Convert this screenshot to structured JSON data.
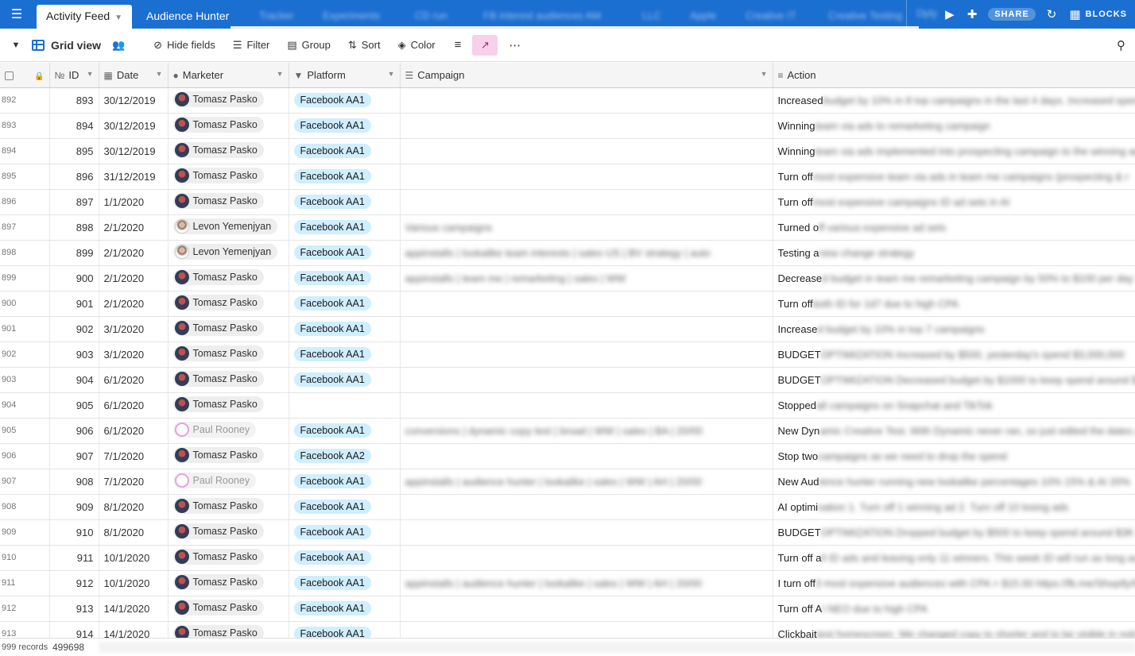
{
  "topbar": {
    "tabs": [
      {
        "label": "Activity Feed",
        "active": true
      },
      {
        "label": "Audience Hunter",
        "active": false
      }
    ],
    "blurred_tabs": [
      "Tracker",
      "Experiments",
      "CD run",
      "FB interest audiences AM",
      "LLC",
      "Apple",
      "Creative IT",
      "Creative Testing"
    ],
    "dply_label": "Dply",
    "share_label": "SHARE",
    "blocks_label": "BLOCKS",
    "accent": "#1b6fd1"
  },
  "toolbar": {
    "view_name": "Grid view",
    "hide_fields": "Hide fields",
    "filter": "Filter",
    "group": "Group",
    "sort": "Sort",
    "color": "Color"
  },
  "columns": {
    "id": "ID",
    "date": "Date",
    "marketer": "Marketer",
    "platform": "Platform",
    "campaign": "Campaign",
    "action": "Action"
  },
  "rows": [
    {
      "n": "892",
      "id": "893",
      "date": "30/12/2019",
      "marketer": "Tomasz Pasko",
      "av": "tomasz",
      "platform": "Facebook AA1",
      "campaign": "",
      "action": "Increased",
      "action_rest": "budget by 10% in 8 top campaigns in the last 4 days. Increased spend"
    },
    {
      "n": "893",
      "id": "894",
      "date": "30/12/2019",
      "marketer": "Tomasz Pasko",
      "av": "tomasz",
      "platform": "Facebook AA1",
      "campaign": "",
      "action": "Winning",
      "action_rest": "team via ads to remarketing campaign"
    },
    {
      "n": "894",
      "id": "895",
      "date": "30/12/2019",
      "marketer": "Tomasz Pasko",
      "av": "tomasz",
      "platform": "Facebook AA1",
      "campaign": "",
      "action": "Winning",
      "action_rest": "team via ads implemented into prospecting campaign to the winning ad"
    },
    {
      "n": "895",
      "id": "896",
      "date": "31/12/2019",
      "marketer": "Tomasz Pasko",
      "av": "tomasz",
      "platform": "Facebook AA1",
      "campaign": "",
      "action": "Turn off",
      "action_rest": "most expensive team via ads in team me campaigns (prospecting & r"
    },
    {
      "n": "896",
      "id": "897",
      "date": "1/1/2020",
      "marketer": "Tomasz Pasko",
      "av": "tomasz",
      "platform": "Facebook AA1",
      "campaign": "",
      "action": "Turn off",
      "action_rest": "most expensive campaigns ID ad sets in AI"
    },
    {
      "n": "897",
      "id": "898",
      "date": "2/1/2020",
      "marketer": "Levon Yemenjyan",
      "av": "levon",
      "platform": "Facebook AA1",
      "campaign": "Various campaigns",
      "action": "Turned o",
      "action_rest": "ff various expensive ad sets"
    },
    {
      "n": "898",
      "id": "899",
      "date": "2/1/2020",
      "marketer": "Levon Yemenjyan",
      "av": "levon",
      "platform": "Facebook AA1",
      "campaign": "appinstalls | lookalike team interests | sales US | BV strategy | auto",
      "action": "Testing a",
      "action_rest": "new change strategy"
    },
    {
      "n": "899",
      "id": "900",
      "date": "2/1/2020",
      "marketer": "Tomasz Pasko",
      "av": "tomasz",
      "platform": "Facebook AA1",
      "campaign": "appinstalls | team me | remarketing | sales | WW",
      "action": "Decrease",
      "action_rest": "d budget in team me remarketing campaign by 50% to $100 per day"
    },
    {
      "n": "900",
      "id": "901",
      "date": "2/1/2020",
      "marketer": "Tomasz Pasko",
      "av": "tomasz",
      "platform": "Facebook AA1",
      "campaign": "",
      "action": "Turn off",
      "action_rest": "both ID for 1d7 due to high CPA"
    },
    {
      "n": "901",
      "id": "902",
      "date": "3/1/2020",
      "marketer": "Tomasz Pasko",
      "av": "tomasz",
      "platform": "Facebook AA1",
      "campaign": "",
      "action": "Increase",
      "action_rest": "d budget by 10% in top 7 campaigns"
    },
    {
      "n": "902",
      "id": "903",
      "date": "3/1/2020",
      "marketer": "Tomasz Pasko",
      "av": "tomasz",
      "platform": "Facebook AA1",
      "campaign": "",
      "action": "BUDGET",
      "action_rest": "OPTIMIZATION Increased by $500, yesterday's spend $3,000,000"
    },
    {
      "n": "903",
      "id": "904",
      "date": "6/1/2020",
      "marketer": "Tomasz Pasko",
      "av": "tomasz",
      "platform": "Facebook AA1",
      "campaign": "",
      "action": "BUDGET",
      "action_rest": "OPTIMIZATION Decreased budget by $1000 to keep spend around $"
    },
    {
      "n": "904",
      "id": "905",
      "date": "6/1/2020",
      "marketer": "Tomasz Pasko",
      "av": "tomasz",
      "platform": "",
      "campaign": "",
      "action": "Stopped",
      "action_rest": "all campaigns on Snapchat and TikTok"
    },
    {
      "n": "905",
      "id": "906",
      "date": "6/1/2020",
      "marketer": "Paul Rooney",
      "av": "paul",
      "platform": "Facebook AA1",
      "campaign": "conversions | dynamic copy test | broad | WW | sales | BA | 20/00",
      "action": "New Dyn",
      "action_rest": "amic Creative Test. With Dynamic never ran, so just edited the dates a"
    },
    {
      "n": "906",
      "id": "907",
      "date": "7/1/2020",
      "marketer": "Tomasz Pasko",
      "av": "tomasz",
      "platform": "Facebook AA2",
      "campaign": "",
      "action": "Stop two",
      "action_rest": "campaigns as we need to drop the spend"
    },
    {
      "n": "907",
      "id": "908",
      "date": "7/1/2020",
      "marketer": "Paul Rooney",
      "av": "paul",
      "platform": "Facebook AA1",
      "campaign": "appinstalls | audience hunter | lookalike | sales | WW | AH | 20/00",
      "action": "New Aud",
      "action_rest": "ience hunter running new lookalike percentages 10% 15% & AI 20%"
    },
    {
      "n": "908",
      "id": "909",
      "date": "8/1/2020",
      "marketer": "Tomasz Pasko",
      "av": "tomasz",
      "platform": "Facebook AA1",
      "campaign": "",
      "action": "AI optimi",
      "action_rest": "sation 1. Turn off 1 winning ad 2. Turn off 10 losing ads"
    },
    {
      "n": "909",
      "id": "910",
      "date": "8/1/2020",
      "marketer": "Tomasz Pasko",
      "av": "tomasz",
      "platform": "Facebook AA1",
      "campaign": "",
      "action": "BUDGET",
      "action_rest": "OPTIMIZATION Dropped budget by $500 to keep spend around $3K"
    },
    {
      "n": "910",
      "id": "911",
      "date": "10/1/2020",
      "marketer": "Tomasz Pasko",
      "av": "tomasz",
      "platform": "Facebook AA1",
      "campaign": "",
      "action": "Turn off a",
      "action_rest": "ll ID ads and leaving only 11 winners. This week ID will run as long as A"
    },
    {
      "n": "911",
      "id": "912",
      "date": "10/1/2020",
      "marketer": "Tomasz Pasko",
      "av": "tomasz",
      "platform": "Facebook AA1",
      "campaign": "appinstalls | audience hunter | lookalike | sales | WW | AH | 20/00",
      "action": "I turn off",
      "action_rest": "3 most expensive audiences with CPA > $15.00 https://fb.me/Shopify/lo"
    },
    {
      "n": "912",
      "id": "913",
      "date": "14/1/2020",
      "marketer": "Tomasz Pasko",
      "av": "tomasz",
      "platform": "Facebook AA1",
      "campaign": "",
      "action": "Turn off A",
      "action_rest": "I NEO due to high CPA"
    },
    {
      "n": "913",
      "id": "914",
      "date": "14/1/2020",
      "marketer": "Tomasz Pasko",
      "av": "tomasz",
      "platform": "Facebook AA1",
      "campaign": "",
      "action": "Clickbait",
      "action_rest": "test homescreen. We changed copy to shorter and to be visible in noti"
    }
  ],
  "footer": {
    "records": "999 records",
    "sum": "499698"
  }
}
